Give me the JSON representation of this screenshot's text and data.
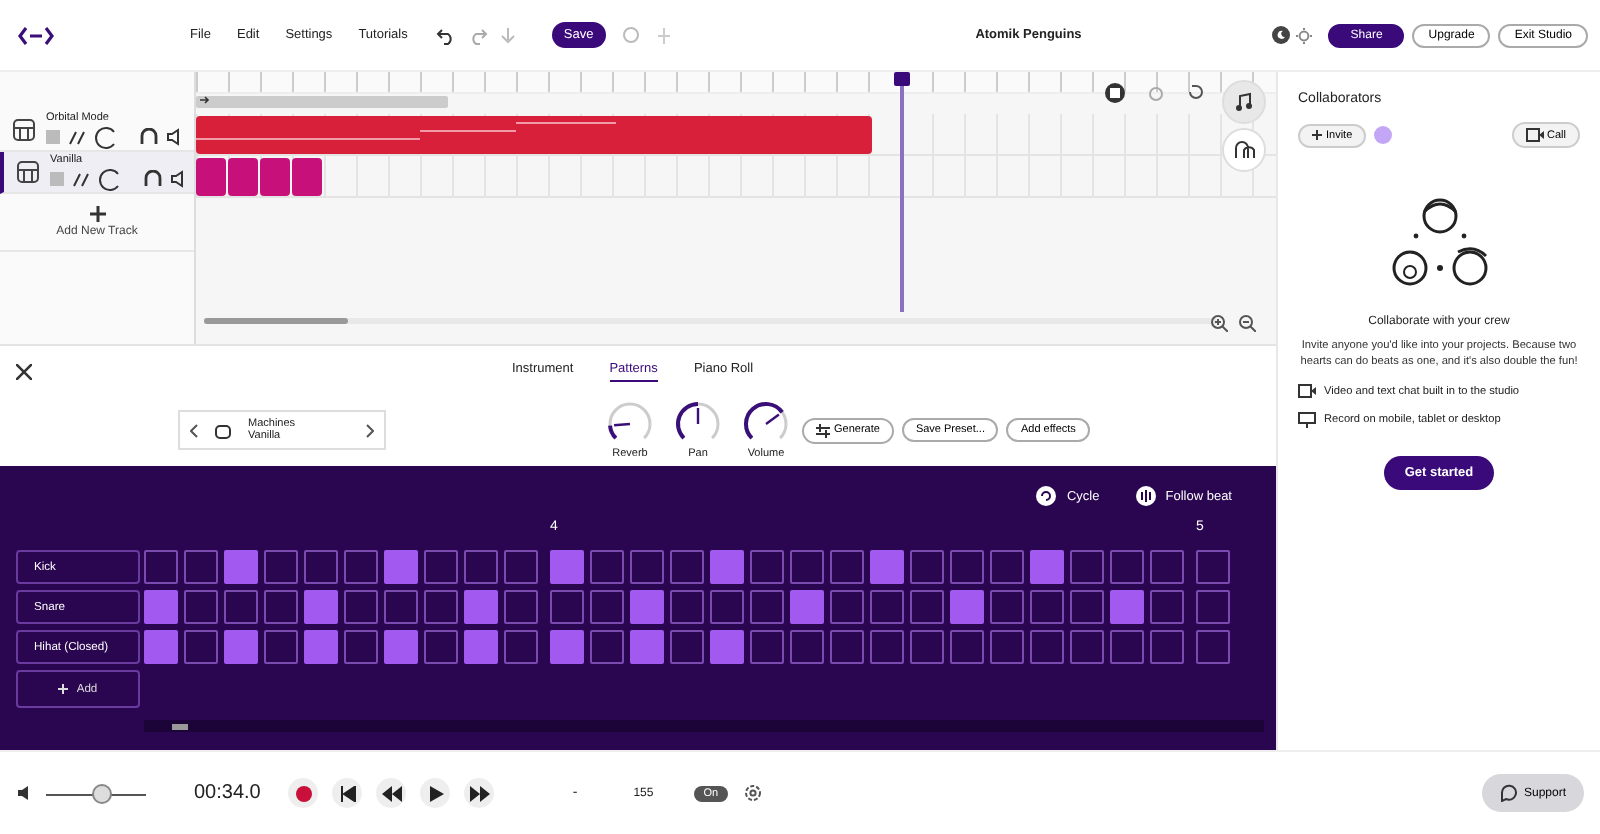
{
  "app_bar": {
    "menu": [
      "File",
      "Edit",
      "Settings",
      "Tutorials"
    ],
    "save": "Save",
    "project_title": "Atomik Penguins",
    "buttons": [
      {
        "label": "Share",
        "kind": "primary"
      },
      {
        "label": "Upgrade",
        "kind": "upgrade"
      },
      {
        "label": "Exit Studio",
        "kind": "exit"
      }
    ]
  },
  "tracks": [
    {
      "name": "Orbital Mode",
      "kind": "synth",
      "color": "#d8203a",
      "selected": false
    },
    {
      "name": "Vanilla",
      "kind": "drums",
      "color": "#c8107a",
      "selected": true
    }
  ],
  "add_track": "Add New Track",
  "collaborators": {
    "title": "Collaborators",
    "invite": "Invite",
    "call": "Call",
    "heading": "Collaborate with your crew",
    "body": "Invite anyone you'd like into your projects. Because two hearts can do beats as one, and it's also double the fun!",
    "features": [
      {
        "kind": "video",
        "text": "Video and text chat built in to the studio"
      },
      {
        "kind": "device",
        "text": "Record on mobile, tablet or desktop"
      }
    ],
    "cta": "Get started"
  },
  "editor": {
    "tabs": [
      {
        "label": "Instrument",
        "selected": false
      },
      {
        "label": "Patterns",
        "selected": true
      },
      {
        "label": "Piano Roll",
        "selected": false
      }
    ],
    "preset": {
      "category": "Machines",
      "name": "Vanilla"
    },
    "knobs": [
      {
        "label": "Reverb",
        "level": 0.15
      },
      {
        "label": "Pan",
        "level": 0.5
      },
      {
        "label": "Volume",
        "level": 0.7
      }
    ],
    "actions": [
      {
        "label": "Generate",
        "kind": "generate"
      },
      {
        "label": "Save Preset...",
        "kind": "plain"
      },
      {
        "label": "Add effects",
        "kind": "plain"
      }
    ],
    "cycle": "Cycle",
    "follow_beat": "Follow beat",
    "bar_numbers": [
      "4",
      "5"
    ],
    "rows": [
      {
        "name": "Kick",
        "bars": [
          [
            false,
            false,
            true,
            false,
            false,
            false,
            true,
            false,
            false,
            false
          ],
          [
            true,
            false,
            false,
            false,
            true,
            false,
            false,
            false,
            true,
            false,
            false,
            false,
            true,
            false,
            false,
            false
          ],
          [
            false
          ]
        ]
      },
      {
        "name": "Snare",
        "bars": [
          [
            true,
            false,
            false,
            false,
            true,
            false,
            false,
            false,
            true,
            false
          ],
          [
            false,
            false,
            true,
            false,
            false,
            false,
            true,
            false,
            false,
            false,
            true,
            false,
            false,
            false,
            true,
            false
          ],
          [
            false
          ]
        ]
      },
      {
        "name": "Hihat (Closed)",
        "bars": [
          [
            true,
            false,
            true,
            false,
            true,
            false,
            true,
            false,
            true,
            false
          ],
          [
            true,
            false,
            true,
            false,
            true,
            false,
            false,
            false,
            false,
            false,
            false,
            false,
            false,
            false,
            false,
            false
          ],
          [
            false
          ]
        ]
      }
    ],
    "add_row": "Add"
  },
  "transport": {
    "volume": {
      "level": 0.55
    },
    "time": "00:34.0",
    "dash": "-",
    "tempo": "155",
    "metronome": "On",
    "support": "Support"
  }
}
